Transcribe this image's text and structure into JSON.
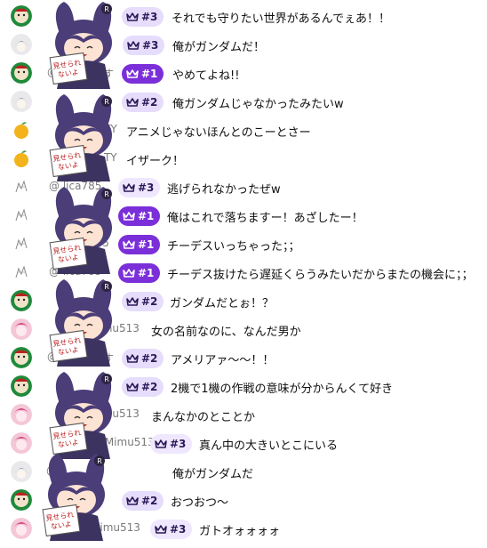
{
  "colors": {
    "badge_lv1": "#7b2fd8",
    "badge_lv2": "#e6dcfb",
    "text": "#0f0f0f",
    "author": "#7a7a7a",
    "mascot_hair": "#4a3d78"
  },
  "rows": [
    {
      "avatar": "green-avatar",
      "author": "",
      "badge": "#3",
      "level": "lv2",
      "text": "それでも守りたい世界があるんでぇあ！！"
    },
    {
      "avatar": "white-avatar",
      "author": "n",
      "badge": "#3",
      "level": "lv2",
      "text": "俺がガンダムだ！"
    },
    {
      "avatar": "green-avatar",
      "author": "@",
      "author2": "す",
      "badge": "#1",
      "level": "lv1",
      "text": "やめてよね!!"
    },
    {
      "avatar": "white-avatar",
      "author": "",
      "badge": "#2",
      "level": "lv2",
      "text": "俺ガンダムじゃなかったみたいw"
    },
    {
      "avatar": "fruit-avatar",
      "author": "TY",
      "badge": "",
      "level": "",
      "text": "アニメじゃないほんとのこーとさー"
    },
    {
      "avatar": "fruit-avatar",
      "author": "ni_TY",
      "badge": "",
      "level": "",
      "text": "イザーク！"
    },
    {
      "avatar": "sketch-avatar",
      "author": "@ lica785",
      "badge": "#3",
      "level": "lv3",
      "text": "逃げられなかったぜw"
    },
    {
      "avatar": "sketch-avatar",
      "author": "",
      "badge": "#1",
      "level": "lv1",
      "text": "俺はこれで落ちますー！あざしたー！"
    },
    {
      "avatar": "sketch-avatar",
      "author": "785",
      "badge": "#1",
      "level": "lv1",
      "text": "チーデスいっちゃった；；"
    },
    {
      "avatar": "sketch-avatar",
      "author": "@ lica785",
      "badge": "#1",
      "level": "lv1",
      "text": "チーデス抜けたら遅延くらうみたいだからまたの機会に；；"
    },
    {
      "avatar": "green-avatar",
      "author": "",
      "badge": "#2",
      "level": "lv2",
      "text": "ガンダムだとぉ！？"
    },
    {
      "avatar": "pink-avatar",
      "author": "Mimu513",
      "badge": "",
      "level": "",
      "text": "女の名前なのに、なんだ男か"
    },
    {
      "avatar": "green-avatar",
      "author": "@",
      "author2": "す",
      "badge": "#2",
      "level": "lv2",
      "text": "アメリアァ〜〜！！"
    },
    {
      "avatar": "green-avatar",
      "author": "",
      "badge": "#2",
      "level": "lv2",
      "text": "2機で1機の作戦の意味が分からんくて好き"
    },
    {
      "avatar": "pink-avatar",
      "author": "Mimu513",
      "badge": "",
      "level": "",
      "text": "まんなかのとことか"
    },
    {
      "avatar": "pink-avatar",
      "author": "@ Mimu513",
      "badge": "#3",
      "level": "lv3",
      "text": "真ん中の大きいとこにいる"
    },
    {
      "avatar": "white-avatar",
      "author": "@",
      "badge": "",
      "level": "",
      "text": "俺がガンダムだ"
    },
    {
      "avatar": "green-avatar",
      "author": "",
      "badge": "#2",
      "level": "lv2",
      "text": "おつおつ〜"
    },
    {
      "avatar": "pink-avatar",
      "author": "Mimu513",
      "badge": "#3",
      "level": "lv3",
      "text": "ガトオォォォォ"
    }
  ],
  "mascot": {
    "sign_line1": "見せられ",
    "sign_line2": "ないよ",
    "ear_mark": "R"
  }
}
